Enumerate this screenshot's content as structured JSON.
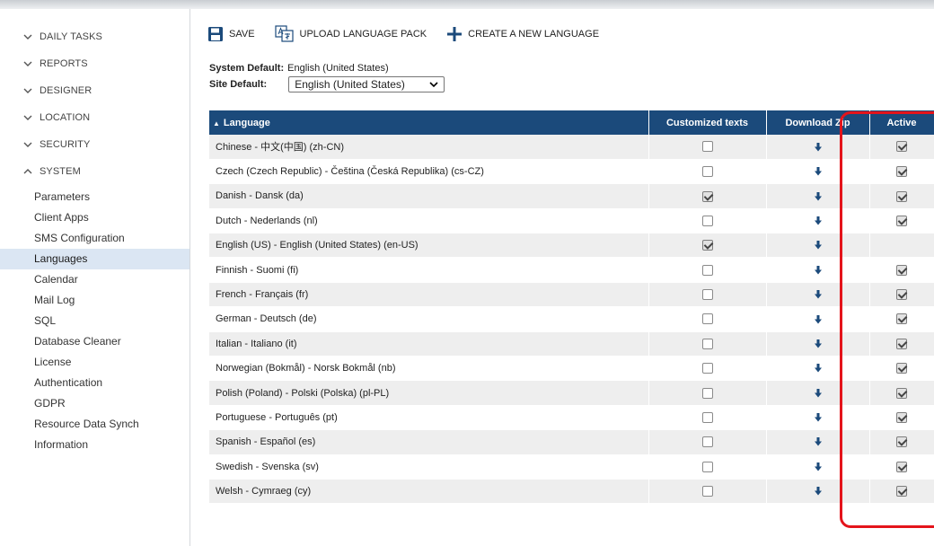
{
  "sidebar": {
    "groups": [
      {
        "label": "DAILY TASKS",
        "expanded": false
      },
      {
        "label": "REPORTS",
        "expanded": false
      },
      {
        "label": "DESIGNER",
        "expanded": false
      },
      {
        "label": "LOCATION",
        "expanded": false
      },
      {
        "label": "SECURITY",
        "expanded": false
      },
      {
        "label": "SYSTEM",
        "expanded": true
      }
    ],
    "system_items": [
      "Parameters",
      "Client Apps",
      "SMS Configuration",
      "Languages",
      "Calendar",
      "Mail Log",
      "SQL",
      "Database Cleaner",
      "License",
      "Authentication",
      "GDPR",
      "Resource Data Synch",
      "Information"
    ],
    "active_item": "Languages"
  },
  "toolbar": {
    "save_label": "SAVE",
    "upload_label": "UPLOAD LANGUAGE PACK",
    "create_label": "CREATE A NEW LANGUAGE"
  },
  "defaults": {
    "system_label": "System Default:",
    "system_value": "English (United States)",
    "site_label": "Site Default:",
    "site_value": "English (United States)"
  },
  "table": {
    "sort_indicator": "▲",
    "headers": {
      "language": "Language",
      "customized": "Customized texts",
      "download": "Download Zip",
      "active": "Active"
    },
    "rows": [
      {
        "language": "Chinese - 中文(中国) (zh-CN)",
        "customized": false,
        "active": true
      },
      {
        "language": "Czech (Czech Republic) - Čeština (Česká Republika) (cs-CZ)",
        "customized": false,
        "active": true
      },
      {
        "language": "Danish - Dansk (da)",
        "customized": true,
        "active": true
      },
      {
        "language": "Dutch - Nederlands (nl)",
        "customized": false,
        "active": true
      },
      {
        "language": "English (US) - English (United States) (en-US)",
        "customized": true,
        "active": null
      },
      {
        "language": "Finnish - Suomi (fi)",
        "customized": false,
        "active": true
      },
      {
        "language": "French - Français (fr)",
        "customized": false,
        "active": true
      },
      {
        "language": "German - Deutsch (de)",
        "customized": false,
        "active": true
      },
      {
        "language": "Italian - Italiano (it)",
        "customized": false,
        "active": true
      },
      {
        "language": "Norwegian (Bokmål) - Norsk Bokmål (nb)",
        "customized": false,
        "active": true
      },
      {
        "language": "Polish (Poland) - Polski (Polska) (pl-PL)",
        "customized": false,
        "active": true
      },
      {
        "language": "Portuguese - Português (pt)",
        "customized": false,
        "active": true
      },
      {
        "language": "Spanish - Español (es)",
        "customized": false,
        "active": true
      },
      {
        "language": "Swedish - Svenska (sv)",
        "customized": false,
        "active": true
      },
      {
        "language": "Welsh - Cymraeg (cy)",
        "customized": false,
        "active": true
      }
    ]
  },
  "colors": {
    "header_bg": "#1b4a7b",
    "download_icon": "#1b4a7b",
    "highlight": "#e4141b",
    "active_nav_bg": "#dbe6f3"
  }
}
